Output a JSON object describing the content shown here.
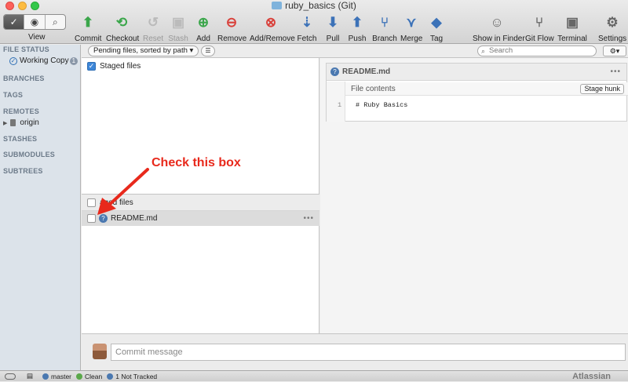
{
  "window": {
    "title": "ruby_basics (Git)"
  },
  "toolbar": {
    "view_label": "View",
    "buttons": [
      {
        "label": "Commit",
        "icon": "commit-icon",
        "color": "#3aa64a",
        "enabled": true
      },
      {
        "label": "Checkout",
        "icon": "checkout-icon",
        "color": "#3aa64a",
        "enabled": true
      },
      {
        "label": "Reset",
        "icon": "reset-icon",
        "color": "#bbbbbb",
        "enabled": false
      },
      {
        "label": "Stash",
        "icon": "stash-icon",
        "color": "#bbbbbb",
        "enabled": false
      },
      {
        "label": "Add",
        "icon": "add-icon",
        "color": "#3aa64a",
        "enabled": true
      },
      {
        "label": "Remove",
        "icon": "remove-icon",
        "color": "#d9403a",
        "enabled": true
      },
      {
        "label": "Add/Remove",
        "icon": "add-remove-icon",
        "color": "#d9403a",
        "enabled": true
      },
      {
        "label": "Fetch",
        "icon": "fetch-icon",
        "color": "#3c72b8",
        "enabled": true
      },
      {
        "label": "Pull",
        "icon": "pull-icon",
        "color": "#3c72b8",
        "enabled": true
      },
      {
        "label": "Push",
        "icon": "push-icon",
        "color": "#3c72b8",
        "enabled": true
      },
      {
        "label": "Branch",
        "icon": "branch-icon",
        "color": "#3c72b8",
        "enabled": true
      },
      {
        "label": "Merge",
        "icon": "merge-icon",
        "color": "#3c72b8",
        "enabled": true
      },
      {
        "label": "Tag",
        "icon": "tag-icon",
        "color": "#3c72b8",
        "enabled": true
      },
      {
        "label": "Show in Finder",
        "icon": "finder-icon",
        "color": "#666666",
        "enabled": true
      },
      {
        "label": "Git Flow",
        "icon": "git-flow-icon",
        "color": "#666666",
        "enabled": true
      },
      {
        "label": "Terminal",
        "icon": "terminal-icon",
        "color": "#666666",
        "enabled": true
      },
      {
        "label": "Settings",
        "icon": "settings-icon",
        "color": "#666666",
        "enabled": true
      }
    ]
  },
  "sidebar": {
    "file_status": "FILE STATUS",
    "working_copy": "Working Copy",
    "working_copy_badge": "1",
    "branches": "BRANCHES",
    "tags": "TAGS",
    "remotes": "REMOTES",
    "origin": "origin",
    "stashes": "STASHES",
    "submodules": "SUBMODULES",
    "subtrees": "SUBTREES"
  },
  "filter": {
    "sort_label": "Pending files, sorted by path",
    "search_placeholder": "Search"
  },
  "staged": {
    "header": "Staged files",
    "checked": true
  },
  "unstaged": {
    "header": "aged files",
    "files": [
      {
        "name": "README.md",
        "status": "untracked"
      }
    ]
  },
  "diff": {
    "file_name": "README.md",
    "hunk_label": "File contents",
    "stage_hunk_label": "Stage hunk",
    "line_number": "1",
    "line_text": "# Ruby Basics"
  },
  "commit": {
    "placeholder": "Commit message"
  },
  "status": {
    "branch": "master",
    "clean": "Clean",
    "not_tracked": "1 Not Tracked",
    "brand": "Atlassian"
  },
  "annotation": {
    "text": "Check this box",
    "color": "#e8291c"
  }
}
